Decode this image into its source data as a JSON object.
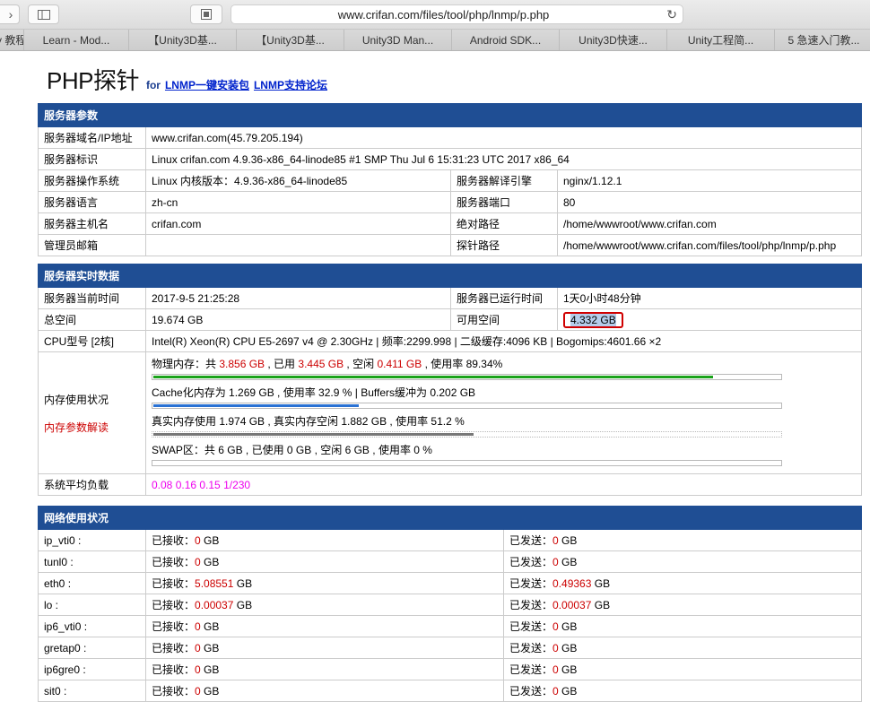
{
  "browser": {
    "url": "www.crifan.com/files/tool/php/lnmp/p.php",
    "bookmarks": [
      "y 教程",
      "Learn - Mod...",
      "【Unity3D基...",
      "【Unity3D基...",
      "Unity3D Man...",
      "Android SDK...",
      "Unity3D快速...",
      "Unity工程简...",
      "5 急速入门教..."
    ]
  },
  "header": {
    "title": "PHP探针",
    "for": "for",
    "link1": "LNMP一键安装包",
    "link2": "LNMP支持论坛"
  },
  "server_params": {
    "title": "服务器参数",
    "rows": [
      {
        "label": "服务器域名/IP地址",
        "value": "www.crifan.com(45.79.205.194)"
      },
      {
        "label": "服务器标识",
        "value": "Linux crifan.com 4.9.36-x86_64-linode85 #1 SMP Thu Jul 6 15:31:23 UTC 2017 x86_64"
      },
      {
        "label": "服务器操作系统",
        "value": "Linux  内核版本：4.9.36-x86_64-linode85",
        "label2": "服务器解译引擎",
        "value2": "nginx/1.12.1"
      },
      {
        "label": "服务器语言",
        "value": "zh-cn",
        "label2": "服务器端口",
        "value2": "80"
      },
      {
        "label": "服务器主机名",
        "value": "crifan.com",
        "label2": "绝对路径",
        "value2": "/home/wwwroot/www.crifan.com"
      },
      {
        "label": "管理员邮箱",
        "value": "",
        "label2": "探针路径",
        "value2": "/home/wwwroot/www.crifan.com/files/tool/php/lnmp/p.php"
      }
    ]
  },
  "realtime": {
    "title": "服务器实时数据",
    "time_label": "服务器当前时间",
    "time_value": "2017-9-5 21:25:28",
    "uptime_label": "服务器已运行时间",
    "uptime_value": "1天0小时48分钟",
    "total_label": "总空间",
    "total_value": "19.674 GB",
    "free_label": "可用空间",
    "free_value": "4.332",
    "free_unit": " GB",
    "cpu_label": "CPU型号 [2核]",
    "cpu_value": "Intel(R) Xeon(R) CPU E5-2697 v4 @ 2.30GHz | 频率:2299.998 | 二级缓存:4096 KB | Bogomips:4601.66 ×2",
    "mem_label": "内存使用状况",
    "mem_link": "内存参数解读",
    "physical": {
      "prefix": "物理内存：共 ",
      "total": "3.856 GB",
      "mid1": " , 已用 ",
      "used": "3.445 GB",
      "mid2": " , 空闲 ",
      "free": "0.411 GB",
      "suffix": " , 使用率 89.34%",
      "percent": 89.34,
      "color": "#1aa31a"
    },
    "cache": {
      "text": "Cache化内存为 1.269 GB , 使用率 32.9 % | Buffers缓冲为 0.202 GB",
      "percent": 32.9,
      "color": "#2a72d4"
    },
    "real": {
      "text": "真实内存使用 1.974 GB , 真实内存空闲 1.882 GB , 使用率 51.2 %",
      "percent": 51.2,
      "color": "#777777"
    },
    "swap": {
      "text": "SWAP区：共 6 GB , 已使用 0 GB , 空闲 6 GB , 使用率 0 %",
      "percent": 0,
      "color": "#777777"
    },
    "load_label": "系统平均负载",
    "load_value": "0.08 0.16 0.15 1/230"
  },
  "network": {
    "title": "网络使用状况",
    "recv_label": "已接收：",
    "send_label": "已发送：",
    "unit": " GB",
    "interfaces": [
      {
        "name": "ip_vti0 :",
        "recv": "0",
        "send": "0"
      },
      {
        "name": "tunl0 :",
        "recv": "0",
        "send": "0"
      },
      {
        "name": "eth0 :",
        "recv": "5.08551",
        "send": "0.49363"
      },
      {
        "name": "lo :",
        "recv": "0.00037",
        "send": "0.00037"
      },
      {
        "name": "ip6_vti0 :",
        "recv": "0",
        "send": "0"
      },
      {
        "name": "gretap0 :",
        "recv": "0",
        "send": "0"
      },
      {
        "name": "ip6gre0 :",
        "recv": "0",
        "send": "0"
      },
      {
        "name": "sit0 :",
        "recv": "0",
        "send": "0"
      }
    ]
  }
}
